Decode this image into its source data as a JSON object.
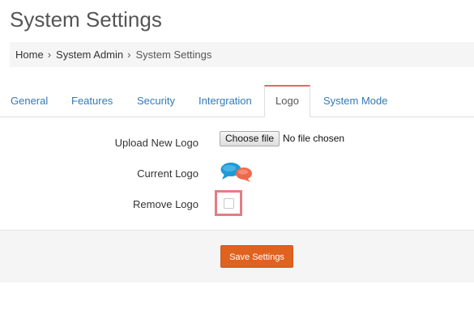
{
  "page": {
    "title": "System Settings"
  },
  "breadcrumb": {
    "items": [
      "Home",
      "System Admin",
      "System Settings"
    ]
  },
  "tabs": [
    {
      "label": "General",
      "active": false
    },
    {
      "label": "Features",
      "active": false
    },
    {
      "label": "Security",
      "active": false
    },
    {
      "label": "Intergration",
      "active": false
    },
    {
      "label": "Logo",
      "active": true
    },
    {
      "label": "System Mode",
      "active": false
    }
  ],
  "form": {
    "upload_label": "Upload New Logo",
    "file_button_label": "Choose file",
    "file_status": "No file chosen",
    "current_logo_label": "Current Logo",
    "current_logo_icon": "chat-bubbles-icon",
    "remove_logo_label": "Remove Logo",
    "remove_logo_checked": false
  },
  "footer": {
    "save_label": "Save Settings"
  },
  "colors": {
    "accent": "#e0621f",
    "tab_link": "#337ab7",
    "active_tab_border": "#e06b6b",
    "highlight_box": "#e57c85",
    "logo_blue": "#1e9bd7",
    "logo_orange": "#ef6a4c"
  }
}
